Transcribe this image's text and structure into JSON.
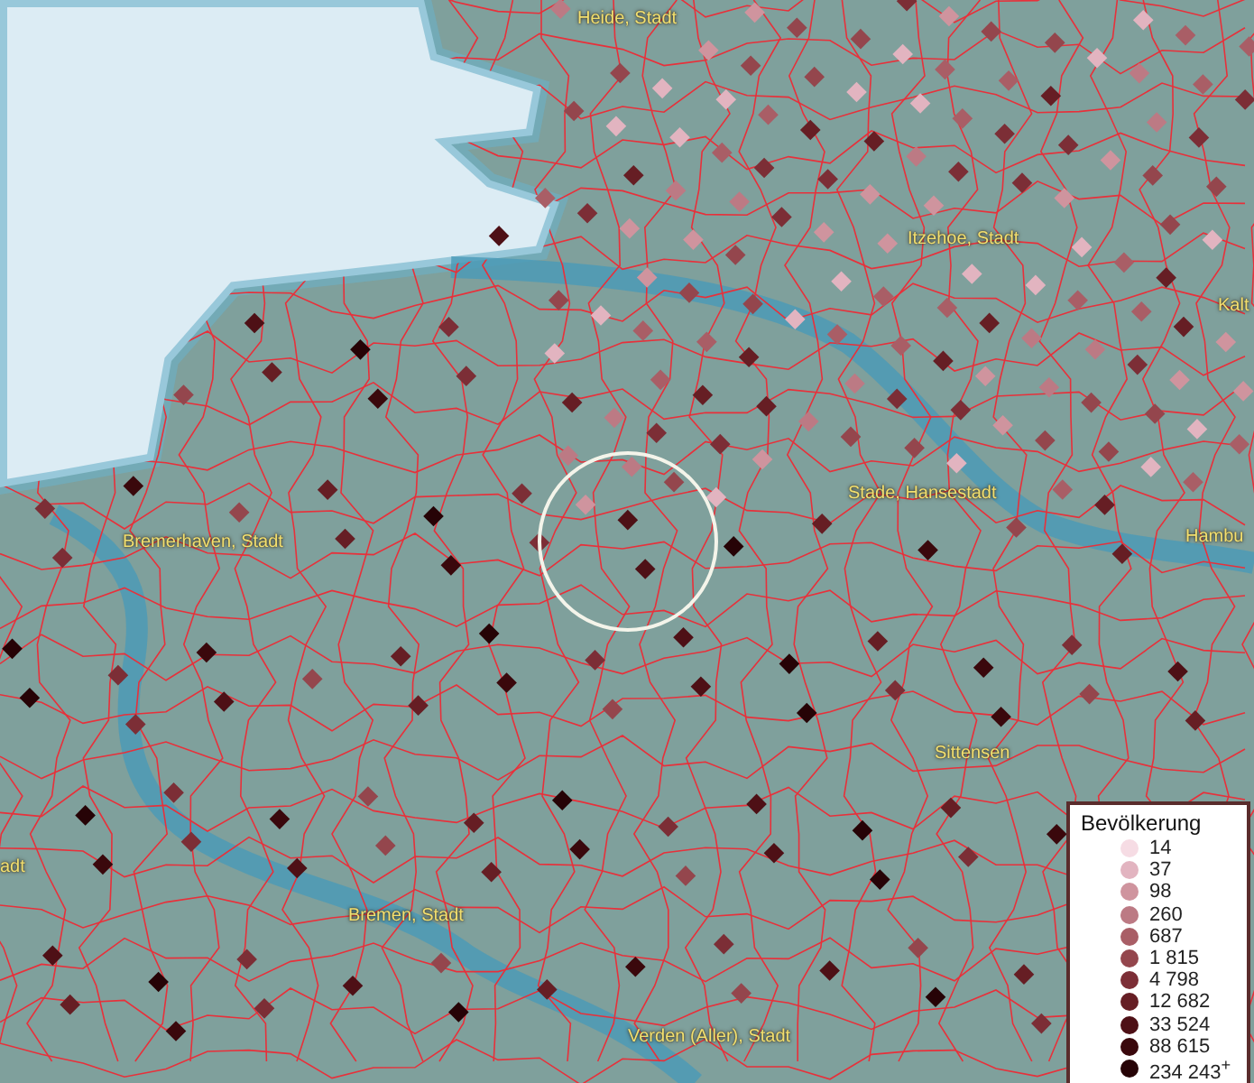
{
  "map": {
    "labels": [
      {
        "text": "Heide, Stadt"
      },
      {
        "text": "Itzehoe, Stadt"
      },
      {
        "text": "Kalt"
      },
      {
        "text": "Stade, Hansestadt"
      },
      {
        "text": "Hambu"
      },
      {
        "text": "Bremerhaven, Stadt"
      },
      {
        "text": "adt"
      },
      {
        "text": "Sittensen"
      },
      {
        "text": "Bremen, Stadt"
      },
      {
        "text": "Verden (Aller), Stadt"
      }
    ]
  },
  "legend": {
    "title": "Bevölkerung",
    "items": [
      {
        "label": "14",
        "color": "#f6dce4"
      },
      {
        "label": "37",
        "color": "#e2b4c0"
      },
      {
        "label": "98",
        "color": "#cf949e"
      },
      {
        "label": "260",
        "color": "#bc7a84"
      },
      {
        "label": "687",
        "color": "#a95e66"
      },
      {
        "label": "1 815",
        "color": "#94464d"
      },
      {
        "label": "4 798",
        "color": "#7c2e36"
      },
      {
        "label": "12 682",
        "color": "#661e24"
      },
      {
        "label": "33 524",
        "color": "#4e1016"
      },
      {
        "label": "88 615",
        "color": "#3a080c"
      },
      {
        "label": "234 243$^{+}$",
        "color": "#260306"
      }
    ]
  }
}
